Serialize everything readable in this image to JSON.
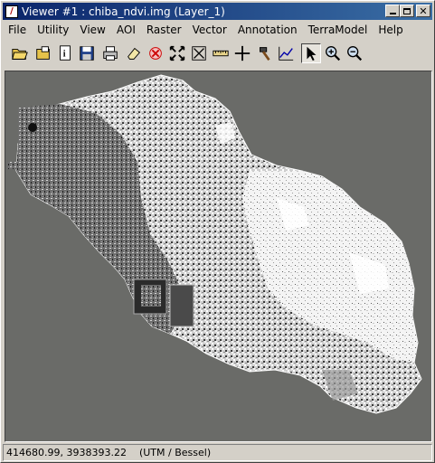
{
  "window": {
    "title": "Viewer #1 : chiba_ndvi.img (Layer_1)",
    "icon": "imagine-viewer-icon"
  },
  "menu": [
    "File",
    "Utility",
    "View",
    "AOI",
    "Raster",
    "Vector",
    "Annotation",
    "TerraModel",
    "Help"
  ],
  "toolbar": [
    {
      "name": "open-folder-icon"
    },
    {
      "name": "open-layer-icon"
    },
    {
      "name": "info-icon"
    },
    {
      "name": "save-icon"
    },
    {
      "name": "print-icon"
    },
    {
      "name": "eraser-icon"
    },
    {
      "name": "clear-view-icon"
    },
    {
      "name": "zoom-to-fit-icon"
    },
    {
      "name": "fit-window-icon"
    },
    {
      "name": "measure-icon"
    },
    {
      "name": "crosshair-icon"
    },
    {
      "name": "hammer-icon"
    },
    {
      "name": "profile-icon"
    },
    {
      "name": "select-arrow-icon",
      "pressed": true
    },
    {
      "name": "zoom-in-icon"
    },
    {
      "name": "zoom-out-icon"
    }
  ],
  "status": {
    "coordinates": "414680.99, 3938393.22",
    "projection": "(UTM / Bessel)"
  },
  "colors": {
    "viewer_background": "#6a6b68",
    "title_start": "#0a246a",
    "title_end": "#3a6ea5"
  }
}
